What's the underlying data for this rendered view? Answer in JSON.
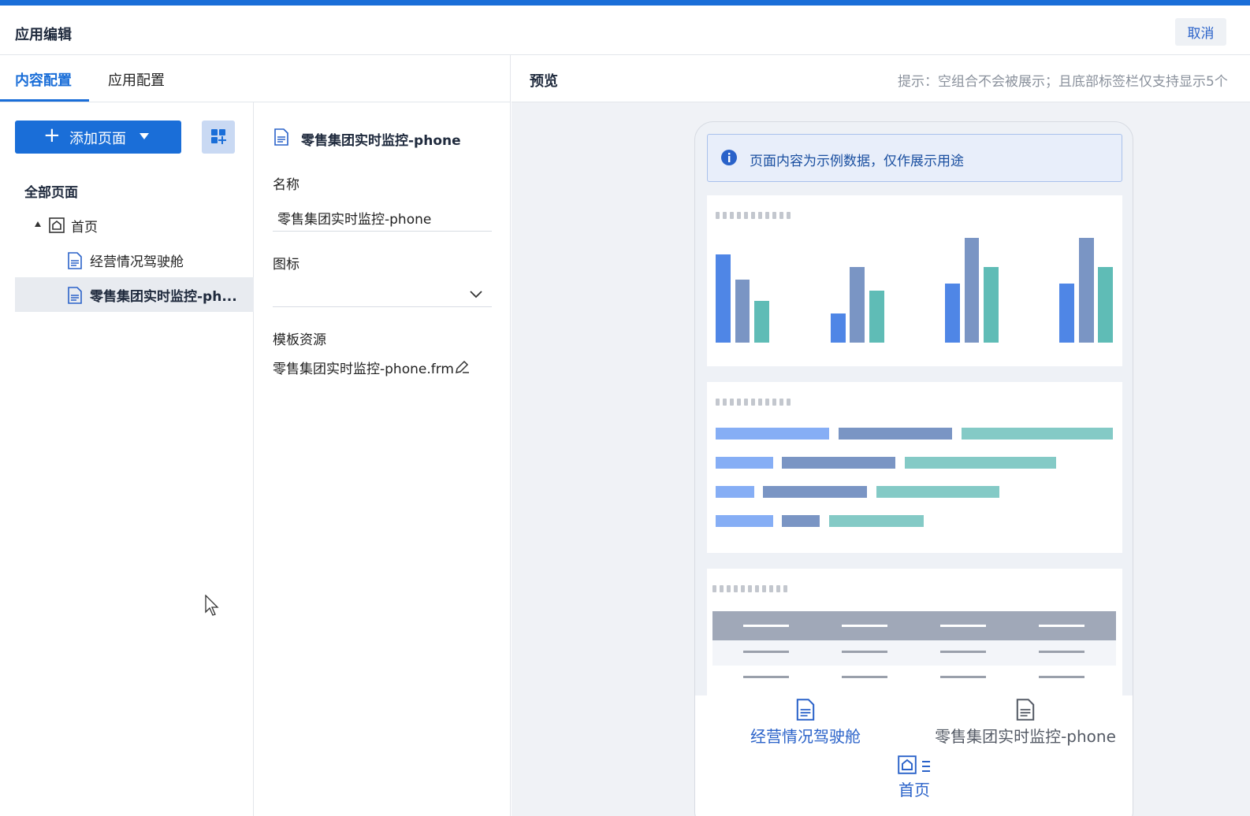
{
  "header": {
    "title": "应用编辑",
    "cancel_label": "取消"
  },
  "tabs": [
    {
      "label": "内容配置",
      "active": true
    },
    {
      "label": "应用配置",
      "active": false
    }
  ],
  "tree": {
    "add_page_label": "添加页面",
    "root_label": "全部页面",
    "nodes": [
      {
        "label": "首页",
        "icon": "home-icon",
        "expanded": true
      },
      {
        "label": "经营情况驾驶舱",
        "icon": "page-icon"
      },
      {
        "label": "零售集团实时监控-ph...",
        "icon": "page-icon",
        "selected": true
      }
    ]
  },
  "config": {
    "heading": "零售集团实时监控-phone",
    "name_label": "名称",
    "name_value": "零售集团实时监控-phone",
    "icon_label": "图标",
    "icon_value": "",
    "template_label": "模板资源",
    "template_value": "零售集团实时监控-phone.frm"
  },
  "preview": {
    "title": "预览",
    "hint": "提示：空组合不会被展示；且底部标签栏仅支持显示5个",
    "notice": "页面内容为示例数据，仅作展示用途",
    "tabbar": [
      {
        "label": "经营情况驾驶舱",
        "icon": "page-icon",
        "color": "#2a62c9"
      },
      {
        "label": "零售集团实时监控-phone",
        "icon": "page-icon",
        "color": "#555b66"
      },
      {
        "label": "首页",
        "icon": "home-icon",
        "color": "#2a62c9"
      }
    ]
  },
  "colors": {
    "primary": "#1a6ed8",
    "bar_blue": "#4f86e6",
    "bar_slate": "#7a95c4",
    "bar_teal": "#5fbcb6"
  }
}
